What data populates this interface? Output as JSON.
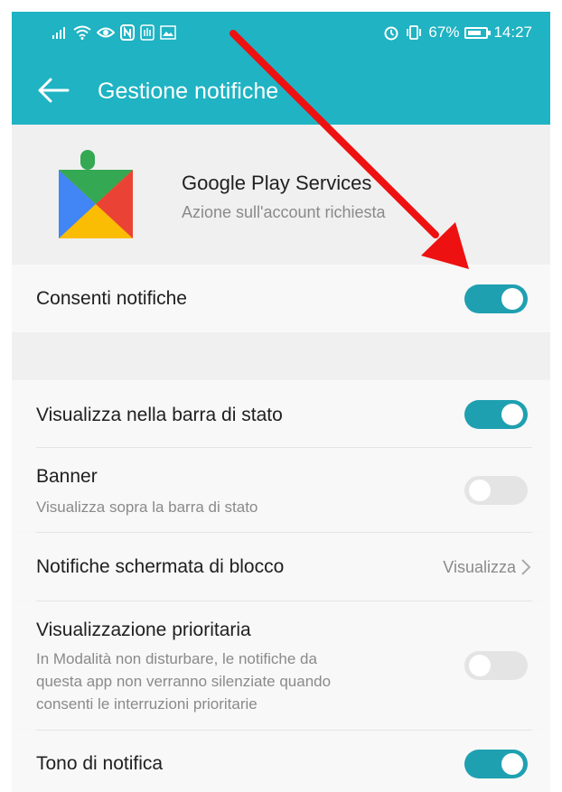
{
  "status_bar": {
    "battery_percent": "67%",
    "time": "14:27",
    "left_icons": [
      "signal-icon",
      "wifi-icon",
      "eye-icon",
      "nfc-icon",
      "hand-icon",
      "gallery-icon"
    ],
    "right_icons": [
      "alarm-icon",
      "vibrate-icon",
      "battery-icon"
    ]
  },
  "appbar": {
    "title": "Gestione notifiche"
  },
  "app": {
    "name": "Google Play Services",
    "subtitle": "Azione sull'account richiesta"
  },
  "settings": [
    {
      "title": "Consenti notifiche",
      "enabled": true
    },
    {
      "title": "Visualizza nella barra di stato",
      "enabled": true
    },
    {
      "title": "Banner",
      "subtitle": "Visualizza sopra la barra di stato",
      "enabled": false
    },
    {
      "title": "Notifiche schermata di blocco",
      "value": "Visualizza"
    },
    {
      "title": "Visualizzazione prioritaria",
      "subtitle_lines": [
        "In Modalità non disturbare, le notifiche da",
        "questa app non verranno silenziate quando",
        "consenti le interruzioni prioritarie"
      ],
      "enabled": false
    },
    {
      "title": "Tono di notifica",
      "enabled": true
    }
  ],
  "colors": {
    "accent": "#1fb3c3",
    "toggle_on": "#1fa0b0",
    "annotation_arrow": "#ee1111"
  }
}
